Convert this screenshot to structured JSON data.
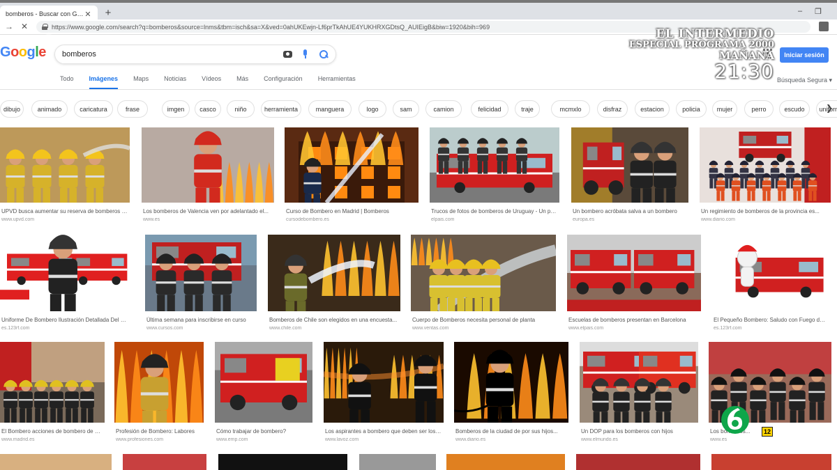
{
  "browser": {
    "tab_title": "bomberos - Buscar con Google",
    "url": "https://www.google.com/search?q=bomberos&source=lnms&tbm=isch&sa=X&ved=0ahUKEwjn-Lf6prTkAhUE4YUKHRXGDtsQ_AUIEigB&biw=1920&bih=969"
  },
  "google": {
    "logo": [
      "G",
      "o",
      "o",
      "g",
      "l",
      "e"
    ],
    "query": "bomberos",
    "signin_label": "Iniciar sesión",
    "safe_search": "Búsqueda Segura ▾",
    "tabs": [
      {
        "label": "Todo",
        "active": false
      },
      {
        "label": "Imágenes",
        "active": true
      },
      {
        "label": "Maps",
        "active": false
      },
      {
        "label": "Noticias",
        "active": false
      },
      {
        "label": "Vídeos",
        "active": false
      },
      {
        "label": "Más",
        "active": false
      },
      {
        "label": "Configuración",
        "active": false
      },
      {
        "label": "Herramientas",
        "active": false
      }
    ],
    "chips": [
      "dibujo",
      "animado",
      "caricatura",
      "frase",
      "imgen",
      "casco",
      "niño",
      "herramienta",
      "manguera",
      "logo",
      "sam",
      "camion",
      "felicidad",
      "traje",
      "mcmxlo",
      "disfraz",
      "estacion",
      "policia",
      "mujer",
      "perro",
      "escudo",
      "uniforme"
    ]
  },
  "overlay": {
    "show": "EL INTERMEDIO",
    "line2": "ESPECIAL PROGRAMA 2000",
    "line3": "MAÑANA",
    "time": "21:30",
    "rating": "12",
    "colors": {
      "channel_green": "#0ea64a"
    }
  },
  "results": [
    {
      "caption": "UPVD busca aumentar su reserva de bomberos - T...",
      "source": "www.upvd.com",
      "scene": "crew",
      "bg": "#b08a4a"
    },
    {
      "caption": "Los bomberos de Valencia ven por adelantado el...",
      "source": "www.es",
      "scene": "fire-walk",
      "bg": "#9a8a82"
    },
    {
      "caption": "Curso de Bombero en Madrid | Bomberos",
      "source": "cursodebombero.es",
      "scene": "building-fire",
      "bg": "#5a2a12"
    },
    {
      "caption": "Trucos de fotos de bomberos de Uruguay - Un poco",
      "source": "elpais.com",
      "scene": "truck",
      "bg": "#7a7a7a"
    },
    {
      "caption": "Un bombero acróbata salva a un bombero",
      "source": "europa.es",
      "scene": "station",
      "bg": "#6b5a4a"
    },
    {
      "caption": "Un regimiento de bomberos de la provincia es...",
      "source": "www.diario.com",
      "scene": "group",
      "bg": "#a04040"
    },
    {
      "caption": "Uniforme De Bombero Ilustración Detallada Del Ba...",
      "source": "es.123rf.com",
      "scene": "illustration",
      "bg": "#ffffff"
    },
    {
      "caption": "Última semana para inscribirse en curso",
      "source": "www.cursos.com",
      "scene": "truck-walk",
      "bg": "#6a7a8a"
    },
    {
      "caption": "Bomberos de Chile son elegidos en una encuesta...",
      "source": "www.chile.com",
      "scene": "hose-fire",
      "bg": "#3a2a1a"
    },
    {
      "caption": "Cuerpo de Bomberos necesita personal de planta",
      "source": "www.ventas.com",
      "scene": "hose-water",
      "bg": "#4a3a2a"
    },
    {
      "caption": "Escuelas de bomberos presentan en Barcelona",
      "source": "www.elpais.com",
      "scene": "trucks",
      "bg": "#8a6a5a"
    },
    {
      "caption": "El Pequeño Bombero: Saludo con Fuego de De...",
      "source": "es.123rf.com",
      "scene": "cartoon",
      "bg": "#ffffff"
    },
    {
      "caption": "El Bombero acciones de bombero de Madrid",
      "source": "www.madrid.es",
      "scene": "crew-row",
      "bg": "#7a6a5a"
    },
    {
      "caption": "Profesión de Bombero: Labores",
      "source": "www.profesiones.com",
      "scene": "firewall",
      "bg": "#c05010"
    },
    {
      "caption": "Cómo trabajar de bombero?",
      "source": "www.emp.com",
      "scene": "red-truck",
      "bg": "#7a7a7a"
    },
    {
      "caption": "Los aspirantes a bombero que deben ser los mejores...",
      "source": "www.lavoz.com",
      "scene": "dark-fire",
      "bg": "#2a1a0a"
    },
    {
      "caption": "Bomberos de la ciudad de por sus hijos...",
      "source": "www.diario.es",
      "scene": "silhouette",
      "bg": "#1a0a00"
    },
    {
      "caption": "Un DOP para los bomberos con hijos",
      "source": "www.elmundo.es",
      "scene": "truck-crew",
      "bg": "#9a8a7a"
    },
    {
      "caption": "Los bomberos...",
      "source": "www.es",
      "scene": "training",
      "bg": "#8a5a4a"
    }
  ]
}
